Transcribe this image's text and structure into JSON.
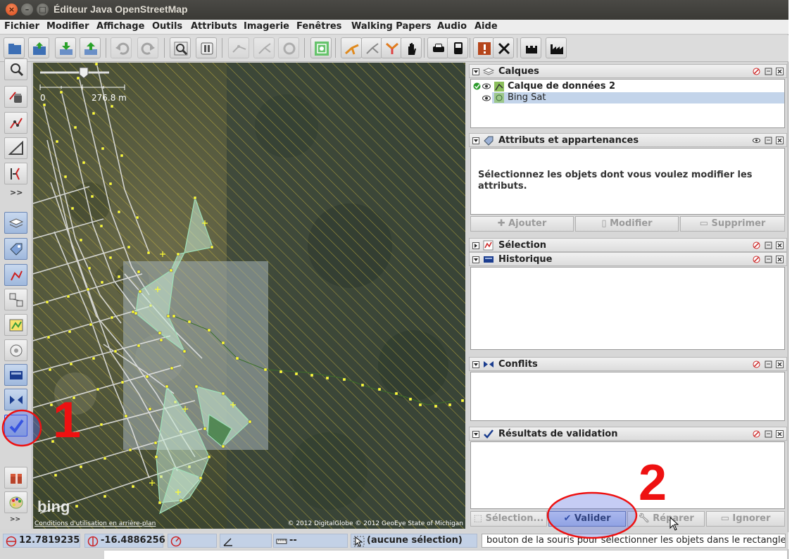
{
  "window": {
    "title": "Éditeur Java OpenStreetMap"
  },
  "menubar": {
    "items": [
      "Fichier",
      "Modifier",
      "Affichage",
      "Outils",
      "Attributs",
      "Imagerie",
      "Fenêtres",
      "Walking Papers",
      "Audio",
      "Aide"
    ]
  },
  "map": {
    "scale_zero": "0",
    "scale_label": "276.8 m",
    "bing_logo": "bing",
    "attribution_left": "Conditions d'utilisation en arrière-plan",
    "attribution_right": "© 2012 DigitalGlobe © 2012 GeoEye State of Michigan"
  },
  "layers_panel": {
    "title": "Calques",
    "layers": [
      {
        "name": "Calque de données 2",
        "active": true,
        "visible": true
      },
      {
        "name": "Bing Sat",
        "active": false,
        "visible": true,
        "selected": true
      }
    ]
  },
  "attributes_panel": {
    "title": "Attributs et appartenances",
    "message": "Sélectionnez les objets dont vous voulez modifier les attributs.",
    "buttons": {
      "add": "Ajouter",
      "edit": "Modifier",
      "delete": "Supprimer"
    }
  },
  "selection_panel": {
    "title": "Sélection"
  },
  "history_panel": {
    "title": "Historique"
  },
  "conflicts_panel": {
    "title": "Conflits"
  },
  "validation_panel": {
    "title": "Résultats de validation",
    "buttons": {
      "selection": "Sélection...",
      "validate": "Valider",
      "fix": "Réparer",
      "ignore": "Ignorer"
    }
  },
  "statusbar": {
    "latitude": "12.7819235",
    "longitude": "-16.4886256",
    "heading": "",
    "angle": "",
    "distance": "--",
    "selection": "(aucune sélection)",
    "message": "bouton de la souris pour sélectionner les objets dans le rectangle."
  },
  "annotations": {
    "marker1": "1",
    "marker2": "2"
  },
  "colors": {
    "highlight": "#1a3fe0",
    "annotation": "#ee1111",
    "selected_row": "#c3d4ea",
    "status_field": "#c3d1e6",
    "way_yellow": "#ffff33"
  }
}
